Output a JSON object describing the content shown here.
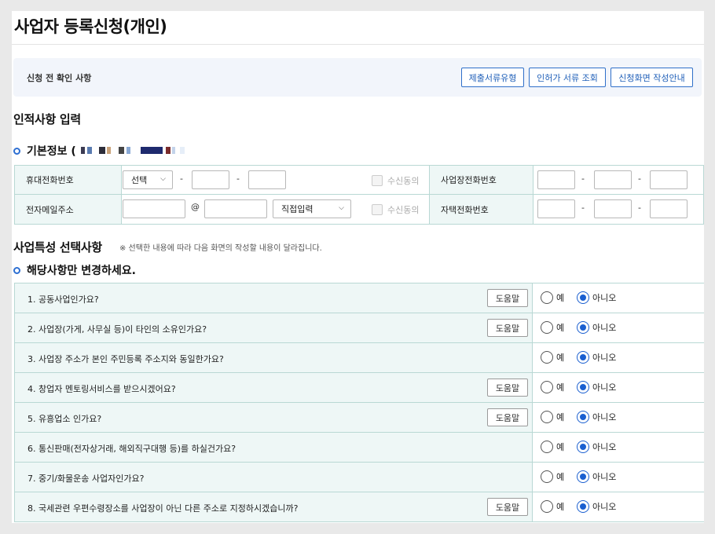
{
  "page": {
    "title": "사업자 등록신청(개인)"
  },
  "precheck": {
    "label": "신청 전 확인 사항",
    "buttons": [
      "제출서류유형",
      "인허가 서류 조회",
      "신청화면 작성안내"
    ]
  },
  "personal": {
    "heading": "인적사항 입력",
    "basic_info_label": "기본정보 (",
    "mobile_label": "휴대전화번호",
    "mobile_select": "선택",
    "email_label": "전자메일주소",
    "email_domain_select": "직접입력",
    "at_sign": "@",
    "dash": "-",
    "consent_label": "수신동의",
    "biz_phone_label": "사업장전화번호",
    "home_phone_label": "자택전화번호"
  },
  "biz": {
    "heading": "사업특성 선택사항",
    "note": "※ 선택한 내용에 따라 다음 화면의 작성할 내용이 달라집니다.",
    "sub_heading": "해당사항만 변경하세요.",
    "help_label": "도움말",
    "yes_label": "예",
    "no_label": "아니오",
    "questions": [
      {
        "text": "1. 공동사업인가요?",
        "help": true,
        "answer": "아니오"
      },
      {
        "text": "2. 사업장(가게, 사무실 등)이 타인의 소유인가요?",
        "help": true,
        "answer": "아니오"
      },
      {
        "text": "3. 사업장 주소가 본인 주민등록 주소지와 동일한가요?",
        "help": false,
        "answer": "아니오"
      },
      {
        "text": "4. 창업자 멘토링서비스를 받으시겠어요?",
        "help": true,
        "answer": "아니오"
      },
      {
        "text": "5. 유흥업소 인가요?",
        "help": true,
        "answer": "아니오"
      },
      {
        "text": "6. 통신판매(전자상거래, 해외직구대행 등)를 하실건가요?",
        "help": false,
        "answer": "아니오"
      },
      {
        "text": "7. 중기/화물운송 사업자인가요?",
        "help": false,
        "answer": "아니오"
      },
      {
        "text": "8. 국세관련 우편수령장소를 사업장이 아닌 다른 주소로 지정하시겠습니까?",
        "help": true,
        "answer": "아니오"
      }
    ]
  }
}
